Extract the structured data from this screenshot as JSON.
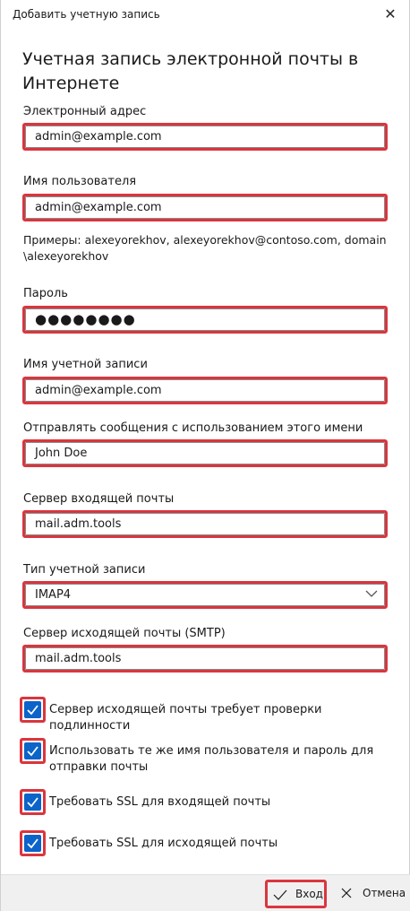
{
  "window": {
    "title": "Добавить учетную запись",
    "close_label": "✕"
  },
  "heading": "Учетная запись электронной почты в Интернете",
  "fields": {
    "email": {
      "label": "Электронный адрес",
      "value": "admin@example.com"
    },
    "username": {
      "label": "Имя пользователя",
      "value": "admin@example.com"
    },
    "username_hint": "Примеры: alexeyorekhov, alexeyorekhov@contoso.com, domain \\alexeyorekhov",
    "password": {
      "label": "Пароль",
      "value": "●●●●●●●●"
    },
    "account_name": {
      "label": "Имя учетной записи",
      "value": "admin@example.com"
    },
    "sender_name": {
      "label": "Отправлять сообщения с использованием этого имени",
      "value": "John Doe"
    },
    "incoming_server": {
      "label": "Сервер входящей почты",
      "value": "mail.adm.tools"
    },
    "account_type": {
      "label": "Тип учетной записи",
      "value": "IMAP4"
    },
    "outgoing_server": {
      "label": "Сервер исходящей почты (SMTP)",
      "value": "mail.adm.tools"
    }
  },
  "checkboxes": [
    {
      "label": "Сервер исходящей почты требует проверки подлинности",
      "checked": true
    },
    {
      "label": "Использовать те же имя пользователя и пароль для отправки почты",
      "checked": true
    },
    {
      "label": "Требовать SSL для входящей почты",
      "checked": true
    },
    {
      "label": "Требовать SSL для исходящей почты",
      "checked": true
    }
  ],
  "footer": {
    "login_label": "Вход",
    "cancel_label": "Отмена"
  },
  "colors": {
    "highlight": "#d9363e",
    "checkbox": "#0a64c9",
    "footer_bg": "#f0f0f0"
  },
  "icons": {
    "close": "close-icon",
    "chevron": "chevron-down-icon",
    "checkmark": "checkmark-icon",
    "login": "checkmark-icon",
    "cancel": "close-icon"
  }
}
